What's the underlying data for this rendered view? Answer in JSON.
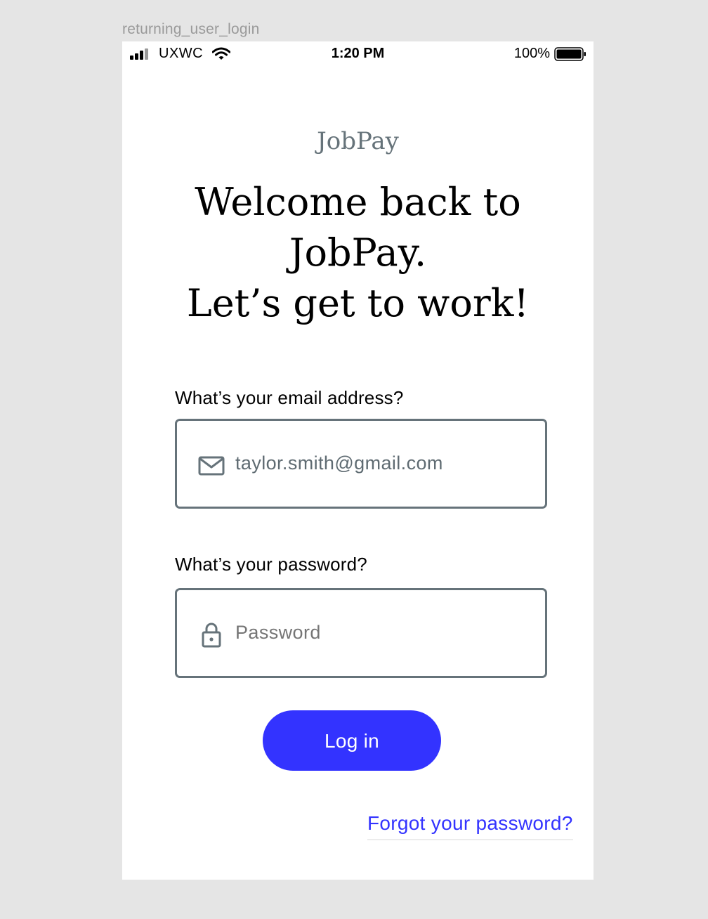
{
  "frame_label": "returning_user_login",
  "status_bar": {
    "carrier": "UXWC",
    "time": "1:20 PM",
    "battery_percent": "100%",
    "signal_icon": "signal-bars-icon",
    "wifi_icon": "wifi-icon",
    "battery_icon": "battery-icon"
  },
  "brand": "JobPay",
  "headline": {
    "line1": "Welcome back to",
    "line2": "JobPay.",
    "line3": "Let’s get to work!"
  },
  "email": {
    "label": "What’s your email address?",
    "value": "taylor.smith@gmail.com",
    "icon": "mail-icon"
  },
  "password": {
    "label": "What’s your password?",
    "placeholder": "Password",
    "icon": "lock-icon"
  },
  "login_button": {
    "label": "Log in",
    "color": "#3333FF"
  },
  "forgot_password": "Forgot your password?",
  "colors": {
    "accent": "#3333FF",
    "field_border": "#66737A",
    "brand": "#66737A"
  }
}
